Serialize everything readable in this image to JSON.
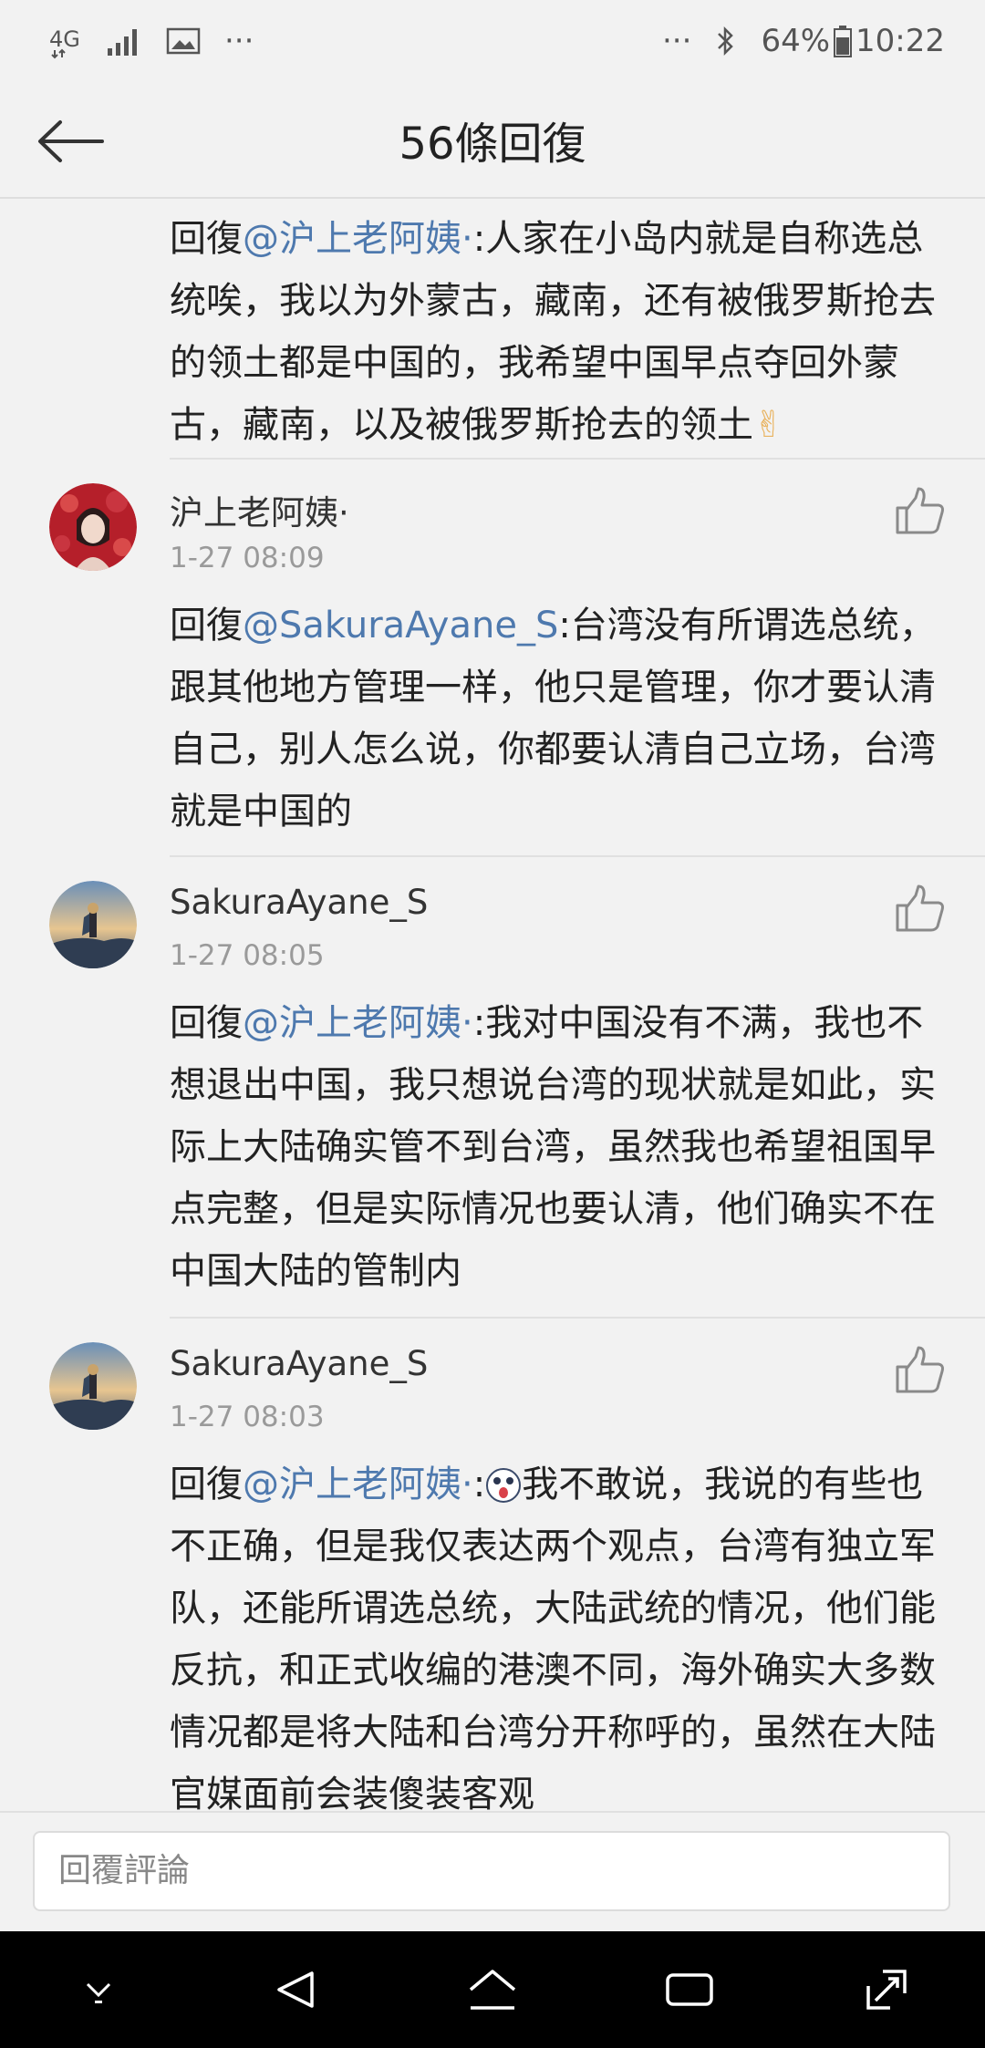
{
  "status_bar": {
    "network": "4G",
    "more_left": "···",
    "more_right": "···",
    "battery": "64%",
    "time": "10:22"
  },
  "header": {
    "title": "56條回復"
  },
  "top_reply": {
    "prefix": "回復",
    "mention": "@沪上老阿姨·",
    "text": ":人家在小岛内就是自称选总统唉，我以为外蒙古，藏南，还有被俄罗斯抢去的领土都是中国的，我希望中国早点夺回外蒙古，藏南，以及被俄罗斯抢去的领土",
    "emoji": "✌"
  },
  "comments": [
    {
      "username": "沪上老阿姨·",
      "time": "1-27 08:09",
      "prefix": "回復",
      "mention": "@SakuraAyane_S",
      "text": ":台湾没有所谓选总统，跟其他地方管理一样，他只是管理，你才要认清自己，别人怎么说，你都要认清自己立场，台湾就是中国的"
    },
    {
      "username": "SakuraAyane_S",
      "time": "1-27 08:05",
      "prefix": "回復",
      "mention": "@沪上老阿姨·",
      "text": ":我对中国没有不满，我也不想退出中国，我只想说台湾的现状就是如此，实际上大陆确实管不到台湾，虽然我也希望祖国早点完整，但是实际情况也要认清，他们确实不在中国大陆的管制内"
    },
    {
      "username": "SakuraAyane_S",
      "time": "1-27 08:03",
      "prefix": "回復",
      "mention": "@沪上老阿姨·",
      "text_before_emoji": ":",
      "text": "我不敢说，我说的有些也不正确，但是我仅表达两个观点，台湾有独立军队，还能所谓选总统，大陆武统的情况，他们能反抗，和正式收编的港澳不同，海外确实大多数情况都是将大陆和台湾分开称呼的，虽然在大陆官媒面前会装傻装客观"
    }
  ],
  "input": {
    "placeholder": "回覆評論"
  },
  "icons": {
    "back": "back-arrow-icon",
    "like": "thumbs-up-icon",
    "nav": [
      "hide-keyboard-icon",
      "back-triangle-icon",
      "home-icon",
      "recent-apps-icon",
      "expand-icon"
    ]
  },
  "colors": {
    "mention": "#4e79ae",
    "time": "#9a9a9a",
    "background": "#f2f2f2"
  }
}
